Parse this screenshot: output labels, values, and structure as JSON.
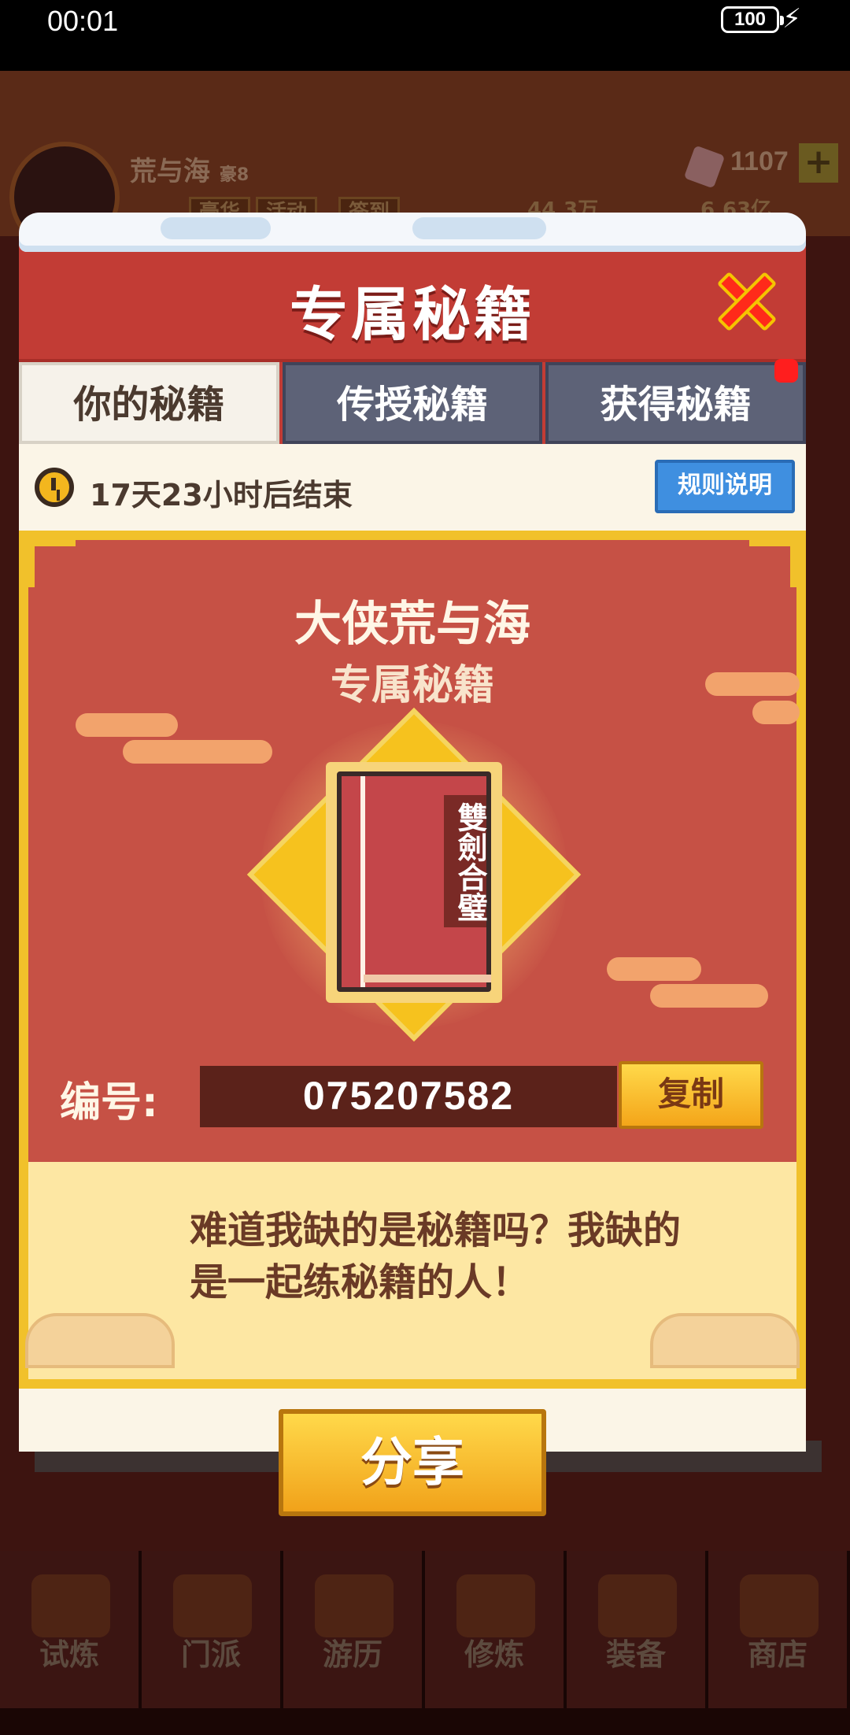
{
  "status_bar": {
    "time": "00:01",
    "battery": "100"
  },
  "background": {
    "player_name": "荒与海",
    "player_tag": "豪8",
    "gems": "1107",
    "mini_buttons": [
      "豪华",
      "活动",
      "签到"
    ],
    "stats": [
      "44.3万",
      "6.63亿"
    ],
    "nav": [
      {
        "label": "试炼"
      },
      {
        "label": "门派"
      },
      {
        "label": "游历"
      },
      {
        "label": "修炼"
      },
      {
        "label": "装备"
      },
      {
        "label": "商店"
      }
    ]
  },
  "dialog": {
    "title": "专属秘籍",
    "tabs": [
      {
        "label": "你的秘籍",
        "active": true
      },
      {
        "label": "传授秘籍",
        "active": false
      },
      {
        "label": "获得秘籍",
        "active": false,
        "badge": true
      }
    ],
    "timer": "17天23小时后结束",
    "rules_label": "规则说明",
    "hero_name": "大侠荒与海",
    "subtitle": "专属秘籍",
    "book_title": "雙劍合璧",
    "code_label": "编号:",
    "code_value": "075207582",
    "copy_label": "复制",
    "quote": "难道我缺的是秘籍吗？我缺的是一起练秘籍的人！",
    "share_label": "分享"
  },
  "colors": {
    "header_red": "#c23c35",
    "card_red": "#c65145",
    "gold": "#f1c12b",
    "tab_inactive": "#5d6277",
    "button_blue": "#3f8fe0"
  }
}
